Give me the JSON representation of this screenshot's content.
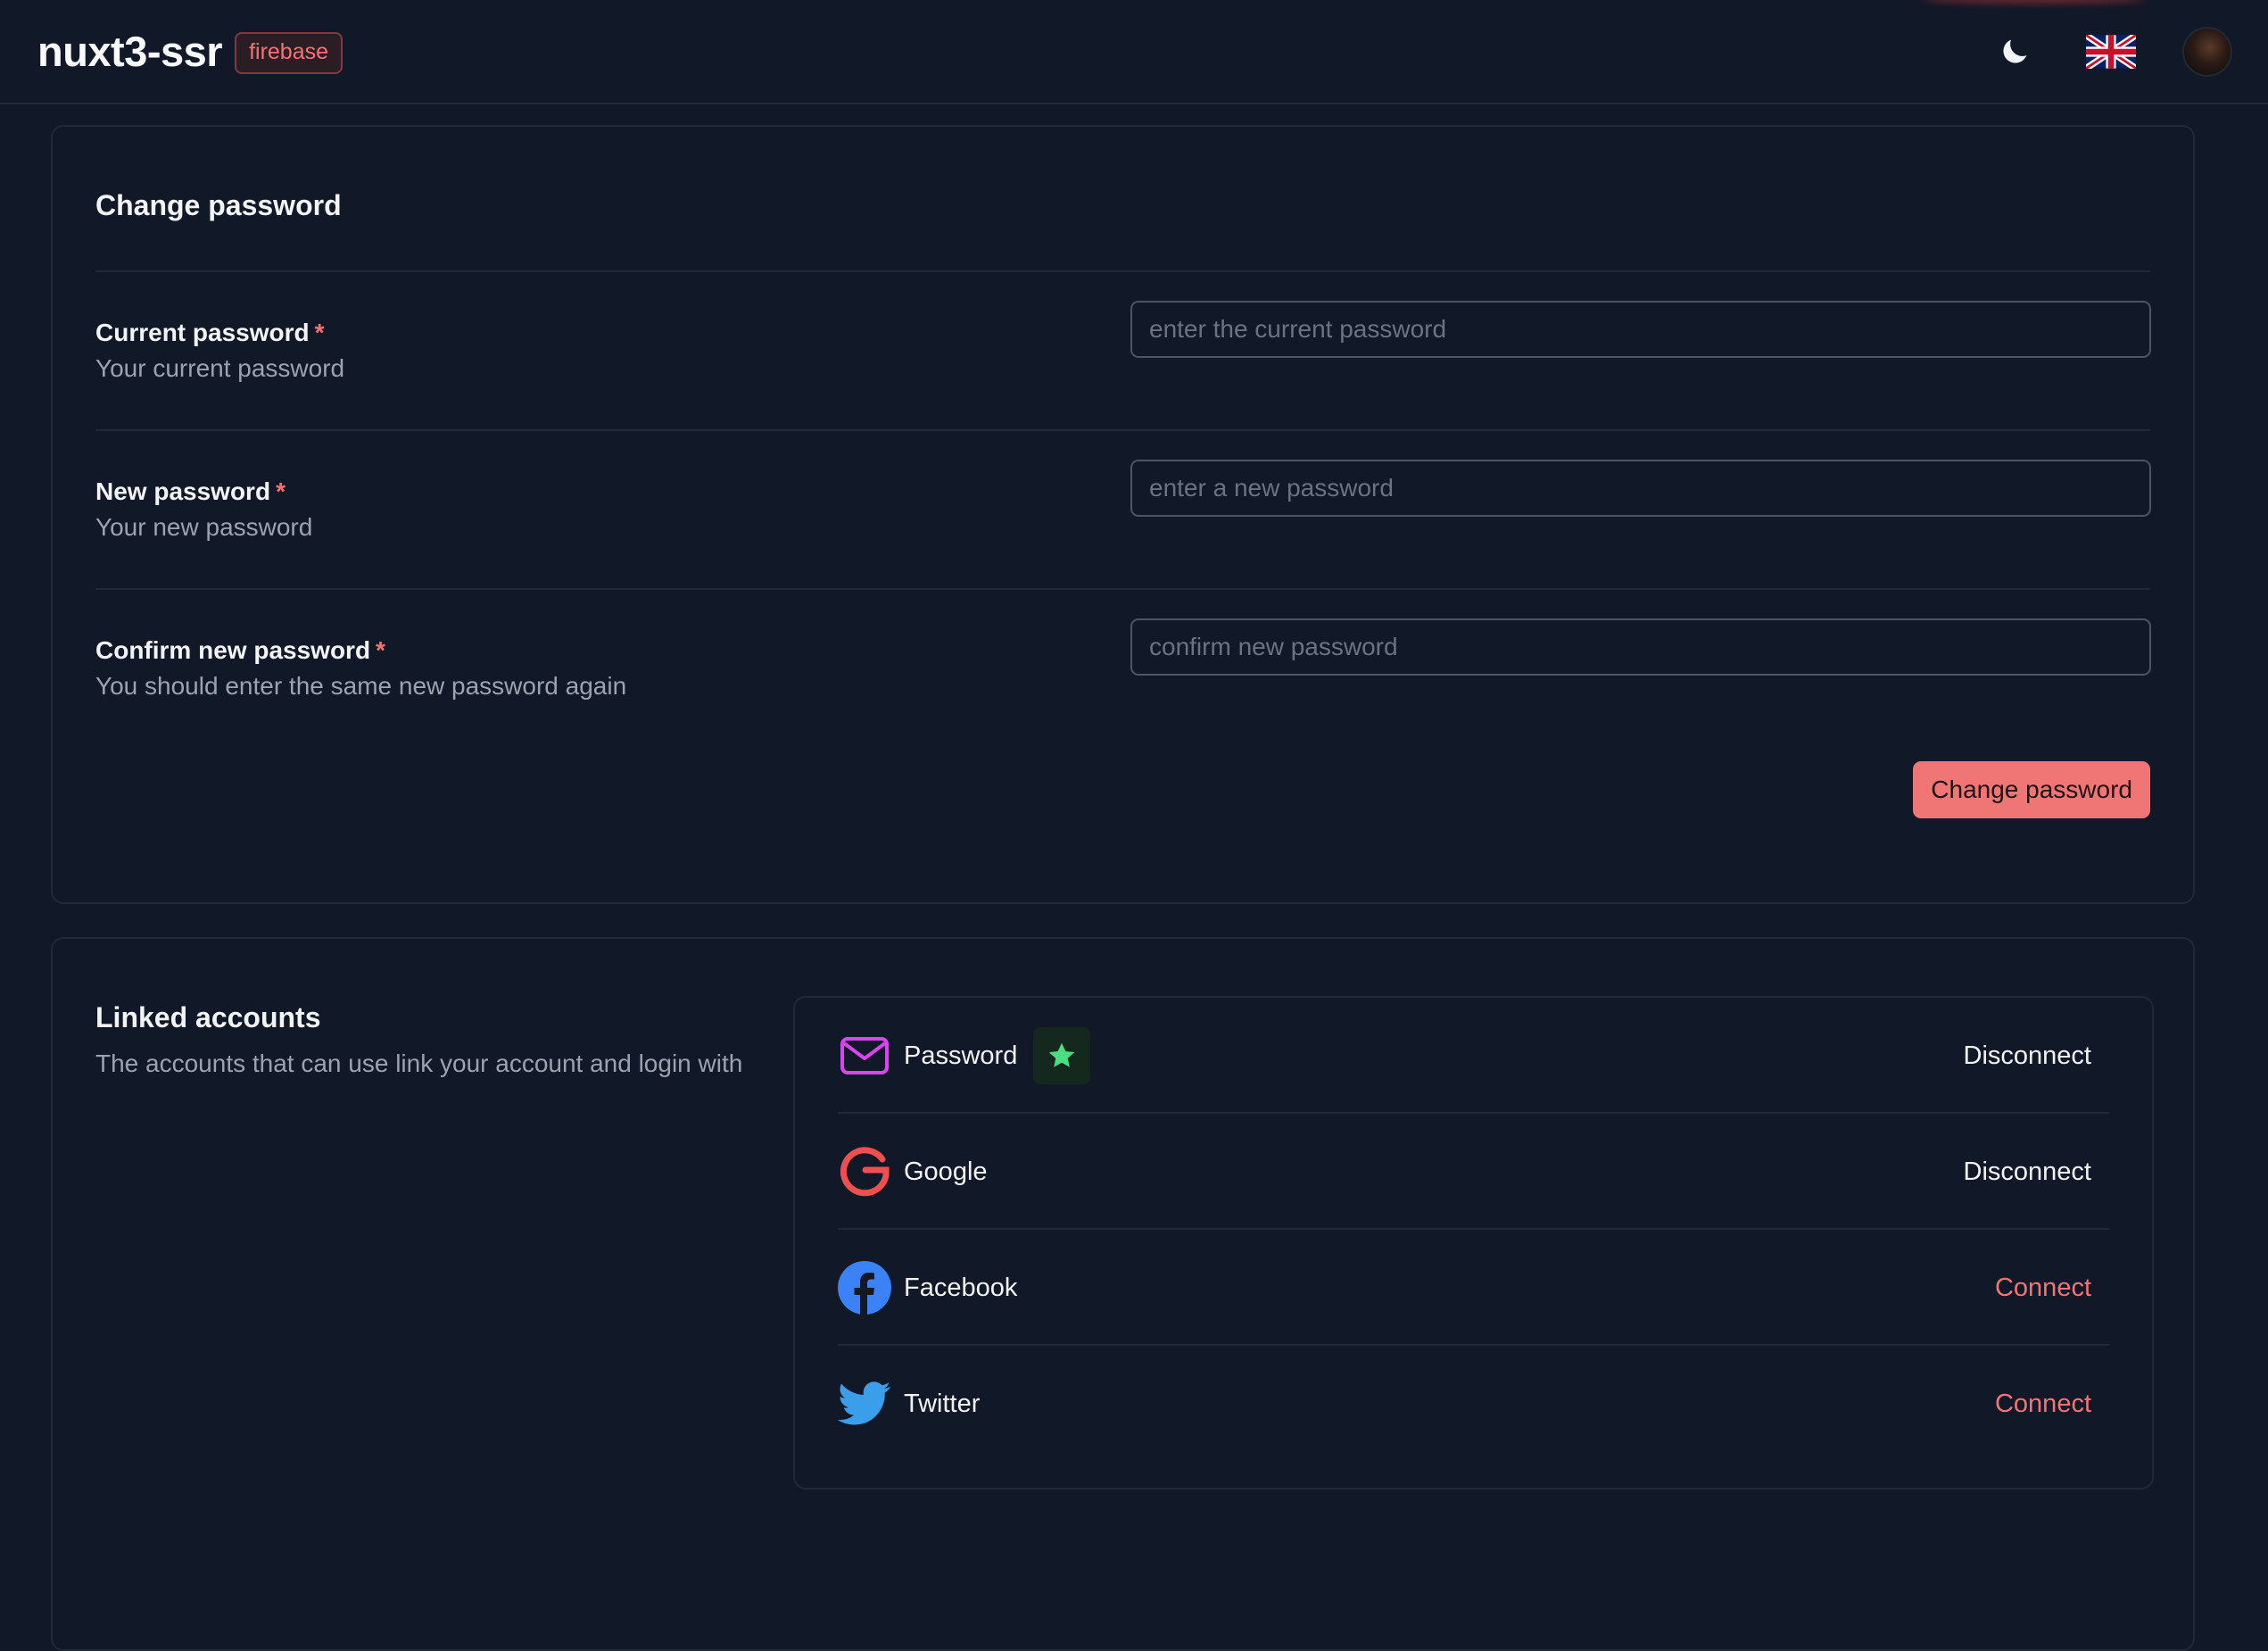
{
  "header": {
    "app_name": "nuxt3-ssr",
    "badge": "firebase",
    "theme_icon": "moon-icon",
    "language_icon": "uk-flag-icon"
  },
  "change_password": {
    "title": "Change password",
    "required_mark": "*",
    "fields": [
      {
        "label": "Current password",
        "help": "Your current password",
        "placeholder": "enter the current password",
        "value": ""
      },
      {
        "label": "New password",
        "help": "Your new password",
        "placeholder": "enter a new password",
        "value": ""
      },
      {
        "label": "Confirm new password",
        "help": "You should enter the same new password again",
        "placeholder": "confirm new password",
        "value": ""
      }
    ],
    "submit_label": "Change password"
  },
  "linked_accounts": {
    "title": "Linked accounts",
    "description": "The accounts that can use link your account and login with",
    "accounts": [
      {
        "name": "Password",
        "icon": "envelope-icon",
        "primary": true,
        "action": "Disconnect"
      },
      {
        "name": "Google",
        "icon": "google-icon",
        "primary": false,
        "action": "Disconnect"
      },
      {
        "name": "Facebook",
        "icon": "facebook-icon",
        "primary": false,
        "action": "Connect"
      },
      {
        "name": "Twitter",
        "icon": "twitter-icon",
        "primary": false,
        "action": "Connect"
      }
    ]
  },
  "colors": {
    "background": "#111827",
    "accent": "#f07575",
    "primary_star": "#4ade80",
    "border": "#1f2937"
  }
}
